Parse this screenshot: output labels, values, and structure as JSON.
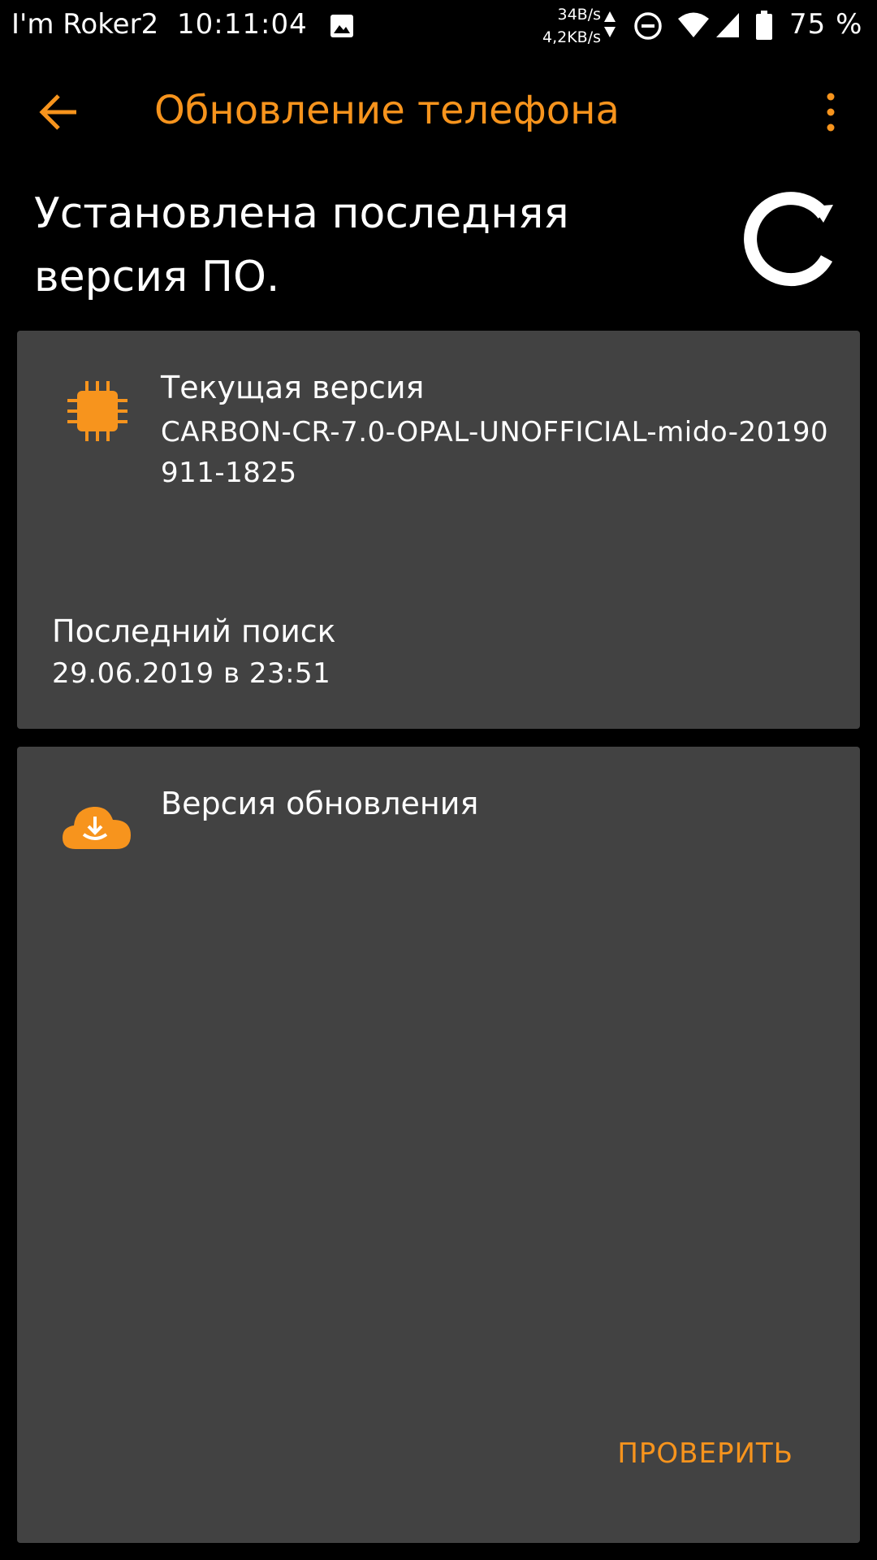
{
  "status_bar": {
    "carrier": "I'm Roker2",
    "time": "10:11:04",
    "speed_up": "34B/s",
    "speed_down": "4,2KB/s",
    "battery_pct": "75 %"
  },
  "app_bar": {
    "title": "Обновление телефона",
    "back_icon": "arrow-back-icon",
    "menu_icon": "more-vert-icon"
  },
  "status": {
    "heading": "Установлена последняя версия ПО.",
    "logo_icon": "carbon-rom-logo-icon"
  },
  "current_card": {
    "label": "Текущая версия",
    "value": "CARBON-CR-7.0-OPAL-UNOFFICIAL-mido-20190911-1825",
    "icon": "chip-icon",
    "last_search_label": "Последний поиск",
    "last_search_value": "29.06.2019 в 23:51"
  },
  "update_card": {
    "label": "Версия обновления",
    "icon": "cloud-download-icon",
    "check_button": "ПРОВЕРИТЬ"
  },
  "colors": {
    "accent": "#f7941d",
    "background": "#000000",
    "card": "#424242",
    "text": "#ffffff"
  }
}
